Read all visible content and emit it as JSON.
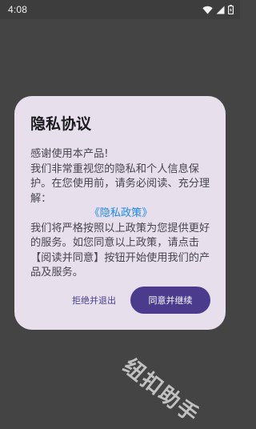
{
  "status_bar": {
    "time": "4:08",
    "icons": [
      "wifi-icon",
      "signal-icon",
      "battery-icon"
    ]
  },
  "dialog": {
    "title": "隐私协议",
    "body_intro": "感谢使用本产品!",
    "body_line2": "我们非常重视您的隐私和个人信息保护。在您使用前，请务必阅读、充分理解：",
    "policy_link": "《隐私政策》",
    "body_line3": "我们将严格按照以上政策为您提供更好的服务。如您同意以上政策，请点击【阅读并同意】按钮开始使用我们的产品及服务。",
    "decline_label": "拒绝并退出",
    "accept_label": "同意并继续"
  },
  "watermark": "纽扣助手",
  "colors": {
    "backdrop": "#444444",
    "dialog_bg": "#e7e0ec",
    "accent": "#4b3b8c",
    "link": "#1e88e5"
  }
}
